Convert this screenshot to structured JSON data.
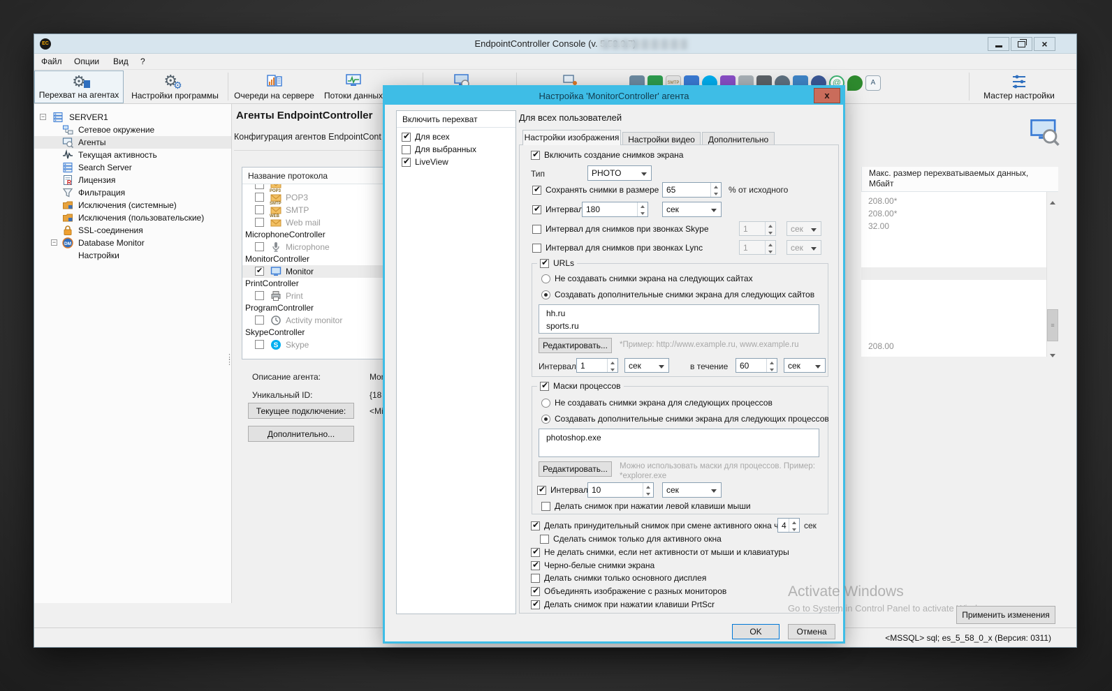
{
  "window": {
    "title": "EndpointController Console (v. 5.58.0.7)",
    "menu": [
      "Файл",
      "Опции",
      "Вид",
      "?"
    ],
    "controls": {
      "minimize": "minimize",
      "restore": "restore",
      "close": "x"
    }
  },
  "toolbar": {
    "buttons": [
      {
        "label": "Перехват на агентах"
      },
      {
        "label": "Настройки программы"
      },
      {
        "label": "Очереди на сервере"
      },
      {
        "label": "Потоки данных"
      }
    ],
    "wizard_label": "Мастер настройки"
  },
  "tree": {
    "items": [
      {
        "label": "SERVER1"
      },
      {
        "label": "Сетевое окружение"
      },
      {
        "label": "Агенты"
      },
      {
        "label": "Текущая активность"
      },
      {
        "label": "Search Server"
      },
      {
        "label": "Лицензия"
      },
      {
        "label": "Фильтрация"
      },
      {
        "label": "Исключения (системные)"
      },
      {
        "label": "Исключения (пользовательские)"
      },
      {
        "label": "SSL-соединения"
      },
      {
        "label": "Database Monitor"
      },
      {
        "label": "Настройки"
      }
    ]
  },
  "agents_panel": {
    "title": "Агенты EndpointController",
    "subtitle": "Конфигурация агентов EndpointCont",
    "list_header": "Название протокола",
    "protocols": [
      {
        "label": "POP3",
        "badge": "POP3"
      },
      {
        "label": "SMTP",
        "badge": "SMTP"
      },
      {
        "label": "Web mail",
        "badge": "WEB"
      },
      {
        "label": "MicrophoneController"
      },
      {
        "label": "Microphone"
      },
      {
        "label": "MonitorController"
      },
      {
        "label": "Monitor"
      },
      {
        "label": "PrintController"
      },
      {
        "label": "Print"
      },
      {
        "label": "ProgramController"
      },
      {
        "label": "Activity monitor"
      },
      {
        "label": "SkypeController"
      },
      {
        "label": "Skype"
      }
    ],
    "fields": {
      "desc_label": "Описание агента:",
      "desc_value": "Mon",
      "uid_label": "Уникальный ID:",
      "uid_value": "{18",
      "conn_button": "Текущее подключение:",
      "conn_value": "<Mi",
      "more_button": "Дополнительно..."
    }
  },
  "data_panel": {
    "header_line1": "Макс. размер перехватываемых данных,",
    "header_line2": "Мбайт",
    "values": [
      "208.00*",
      "208.00*",
      "32.00"
    ],
    "bottom_value": "208.00"
  },
  "apply_button": "Применить изменения",
  "status_bar": "<MSSQL> sql; es_5_58_0_x (Версия: 0311)",
  "watermark": {
    "line1": "Activate Windows",
    "line2": "Go to System in Control Panel to activate Windows"
  },
  "dialog": {
    "title": "Настройка 'MonitorController' агента",
    "close": "x",
    "intercept": {
      "header": "Включить перехват",
      "options": [
        {
          "label": "Для всех",
          "checked": true
        },
        {
          "label": "Для выбранных",
          "checked": false
        },
        {
          "label": "LiveView",
          "checked": true
        }
      ]
    },
    "scope_label": "Для всех пользователей",
    "tabs": [
      {
        "label": "Настройки изображения",
        "active": true
      },
      {
        "label": "Настройки видео",
        "active": false
      },
      {
        "label": "Дополнительно",
        "active": false
      }
    ],
    "image": {
      "enable": "Включить создание снимков экрана",
      "type_label": "Тип",
      "type_value": "PHOTO",
      "save_size": {
        "label": "Сохранять снимки в размере",
        "value": "65",
        "suffix": "% от исходного"
      },
      "interval": {
        "label": "Интервал",
        "value": "180",
        "unit": "сек"
      },
      "skype_interval": {
        "label": "Интервал для снимков при звонках Skype",
        "value": "1",
        "unit": "сек"
      },
      "lync_interval": {
        "label": "Интервал для снимков при звонках Lync",
        "value": "1",
        "unit": "сек"
      },
      "urls": {
        "label": "URLs",
        "radio_exclude": "Не создавать снимки экрана на следующих сайтах",
        "radio_include": "Создавать дополнительные снимки экрана для следующих сайтов",
        "list": [
          "hh.ru",
          "sports.ru"
        ],
        "edit": "Редактировать...",
        "hint": "*Пример: http://www.example.ru, www.example.ru",
        "interval_label": "Интервал",
        "interval_value": "1",
        "interval_unit": "сек",
        "during_label": "в течение",
        "during_value": "60",
        "during_unit": "сек"
      },
      "masks": {
        "label": "Маски процессов",
        "radio_exclude": "Не создавать снимки экрана для следующих процессов",
        "radio_include": "Создавать дополнительные снимки экрана для следующих процессов",
        "list": [
          "photoshop.exe"
        ],
        "edit": "Редактировать...",
        "hint1": "Можно использовать маски для процессов. Пример:",
        "hint2": "*explorer.exe",
        "interval_label": "Интервал",
        "interval_value": "10",
        "interval_unit": "сек",
        "click_label": "Делать снимок при нажатии левой клавиши мыши"
      },
      "force": {
        "label": "Делать принудительный снимок при смене активного окна через",
        "value": "4",
        "unit": "сек"
      },
      "active_only": "Сделать снимок только для активного окна",
      "no_activity": "Не делать снимки, если нет активности от мыши и клавиатуры",
      "bw": "Черно-белые снимки экрана",
      "main_display": "Делать снимки только основного дисплея",
      "combine": "Объединять изображение с разных мониторов",
      "prtscr": "Делать снимок при нажатии клавиши PrtScr"
    },
    "ok": "OK",
    "cancel": "Отмена"
  },
  "colors": {
    "dialog_titlebar": "#3ebde6",
    "dialog_close": "#ca6c5b",
    "window_titlebar": "#d7e5ee",
    "accent_blue": "#3a7bd5",
    "mail_orange": "#e8a33d",
    "skype_blue": "#00aff0"
  }
}
